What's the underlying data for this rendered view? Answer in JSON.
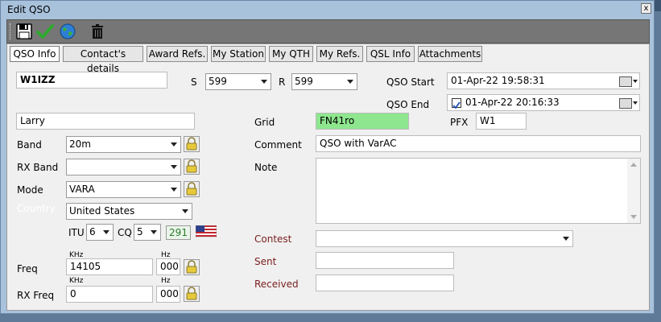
{
  "window": {
    "title": "Edit QSO",
    "close": "x"
  },
  "tabs": [
    {
      "label": "QSO Info"
    },
    {
      "label": "Contact's details"
    },
    {
      "label": "Award Refs."
    },
    {
      "label": "My Station"
    },
    {
      "label": "My QTH"
    },
    {
      "label": "My Refs."
    },
    {
      "label": "QSL Info"
    },
    {
      "label": "Attachments"
    }
  ],
  "qso": {
    "callsign": "W1IZZ",
    "s_label": "S",
    "s_value": "599",
    "r_label": "R",
    "r_value": "599",
    "start_label": "QSO Start",
    "start_value": "01-Apr-22 19:58:31",
    "end_label": "QSO End",
    "end_value": "01-Apr-22 20:16:33"
  },
  "contact": {
    "name": "Larry",
    "band_label": "Band",
    "band_value": "20m",
    "rxband_label": "RX Band",
    "rxband_value": "",
    "mode_label": "Mode",
    "mode_value": "VARA",
    "country_label": "Country",
    "country_value": "United States",
    "itu_label": "ITU",
    "itu_value": "6",
    "cq_label": "CQ",
    "cq_value": "5",
    "dxcc": "291",
    "freq_label": "Freq",
    "freq_khz_unit": "KHz",
    "freq_hz_unit": "Hz",
    "freq_khz": "14105",
    "freq_hz": "000",
    "rxfreq_label": "RX Freq",
    "rxfreq_khz_unit": "KHz",
    "rxfreq_hz_unit": "Hz",
    "rxfreq_khz": "0",
    "rxfreq_hz": "000"
  },
  "details": {
    "grid_label": "Grid",
    "grid_value": "FN41ro",
    "pfx_label": "PFX",
    "pfx_value": "W1",
    "comment_label": "Comment",
    "comment_value": "QSO with VarAC",
    "note_label": "Note",
    "note_value": "",
    "contest_label": "Contest",
    "contest_value": "",
    "sent_label": "Sent",
    "sent_value": "",
    "received_label": "Received",
    "received_value": ""
  },
  "toolbar": {
    "icons": [
      "save-icon",
      "check-icon",
      "globe-icon",
      "trash-icon"
    ]
  },
  "colors": {
    "grid_bg": "#8ee68e",
    "contest_label": "#7a2020",
    "dxcc_text": "#2a7a2a"
  }
}
